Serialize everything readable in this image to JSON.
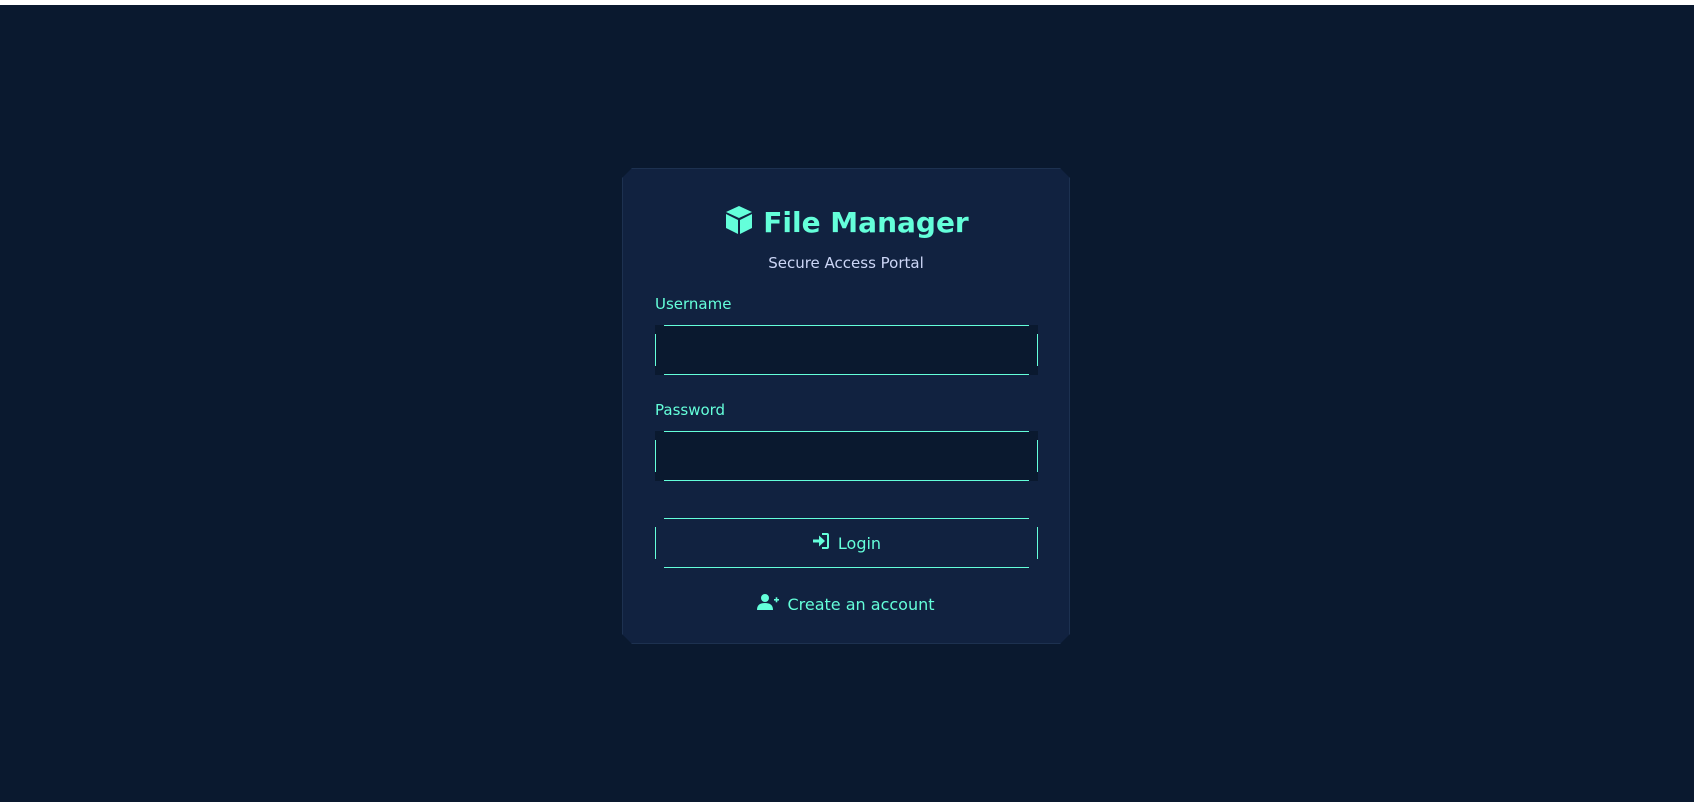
{
  "app": {
    "title": "File Manager",
    "subtitle": "Secure Access Portal"
  },
  "form": {
    "username_label": "Username",
    "username_value": "",
    "password_label": "Password",
    "password_value": "",
    "login_label": "Login"
  },
  "links": {
    "create_account": "Create an account"
  },
  "icons": {
    "logo": "cube-icon",
    "login": "sign-in-icon",
    "register": "user-plus-icon"
  },
  "colors": {
    "background": "#0a192f",
    "card": "#112240",
    "accent": "#64ffda",
    "text": "#ccd6f6"
  }
}
